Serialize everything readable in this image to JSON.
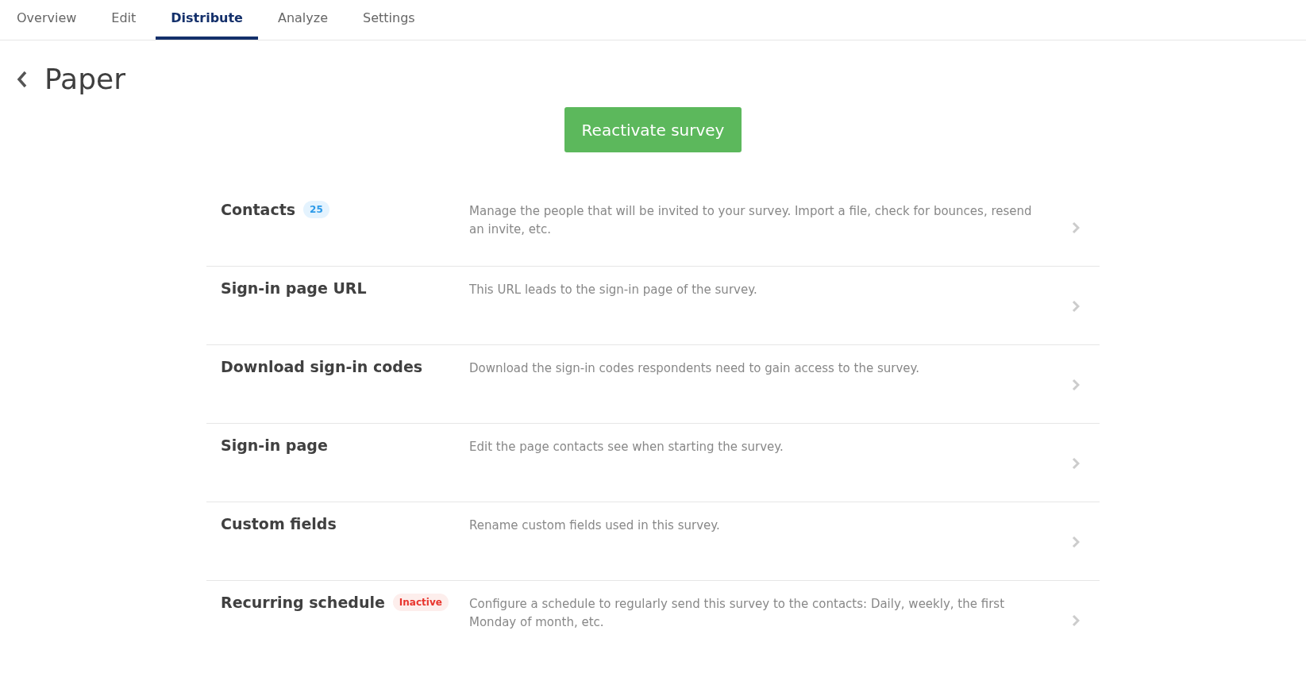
{
  "tabs": [
    {
      "label": "Overview",
      "selected": false
    },
    {
      "label": "Edit",
      "selected": false
    },
    {
      "label": "Distribute",
      "selected": true
    },
    {
      "label": "Analyze",
      "selected": false
    },
    {
      "label": "Settings",
      "selected": false
    }
  ],
  "page": {
    "title": "Paper"
  },
  "primary_button": "Reactivate survey",
  "options": [
    {
      "title": "Contacts",
      "badge": {
        "kind": "count",
        "text": "25"
      },
      "description": "Manage the people that will be invited to your survey. Import a file, check for bounces, resend an invite, etc."
    },
    {
      "title": "Sign-in page URL",
      "description": "This URL leads to the sign-in page of the survey."
    },
    {
      "title": "Download sign-in codes",
      "description": "Download the sign-in codes respondents need to gain access to the survey."
    },
    {
      "title": "Sign-in page",
      "description": "Edit the page contacts see when starting the survey."
    },
    {
      "title": "Custom fields",
      "description": "Rename custom fields used in this survey."
    },
    {
      "title": "Recurring schedule",
      "badge": {
        "kind": "status",
        "text": "Inactive"
      },
      "description": "Configure a schedule to regularly send this survey to the contacts: Daily, weekly, the first Monday of month, etc."
    }
  ]
}
